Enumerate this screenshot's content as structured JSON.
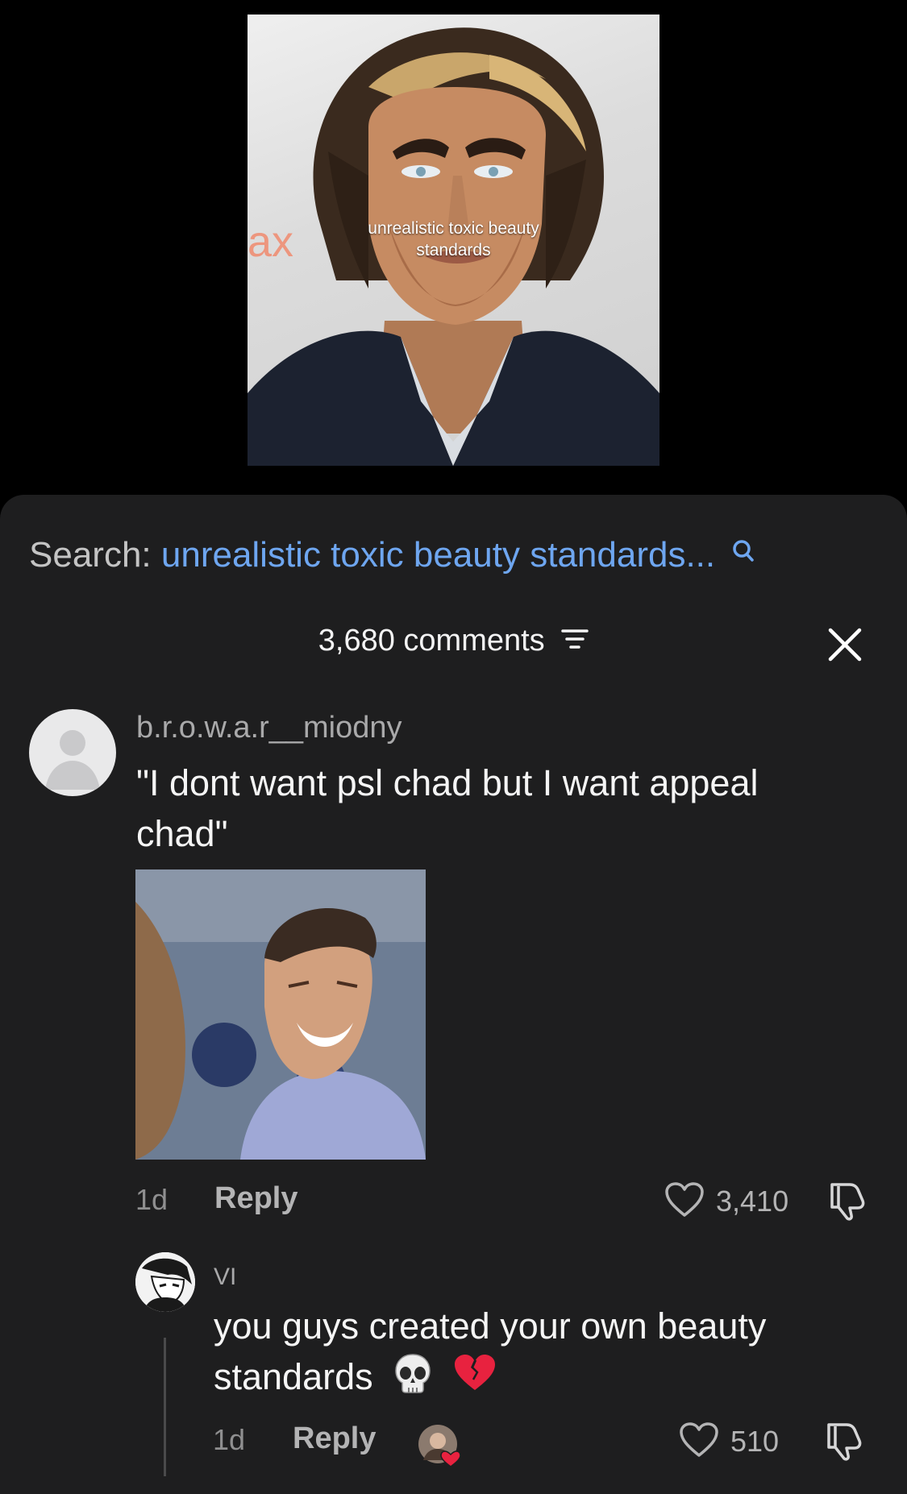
{
  "video": {
    "caption_line1": "unrealistic toxic beauty",
    "caption_line2": "standards",
    "watermark": "ax"
  },
  "search": {
    "prefix": "Search:",
    "query": "unrealistic toxic beauty standards..."
  },
  "comments_header": {
    "count_label": "3,680 comments"
  },
  "comments": [
    {
      "username": "b.r.o.w.a.r__miodny",
      "text": "\"I dont want psl chad but I want appeal chad\"",
      "age": "1d",
      "reply_label": "Reply",
      "likes": "3,410"
    },
    {
      "username": "VI",
      "text": "you guys created your own beauty standards",
      "emojis": [
        "skull-emoji",
        "broken-heart-emoji"
      ],
      "age": "1d",
      "reply_label": "Reply",
      "likes": "510"
    }
  ],
  "colors": {
    "panel_bg": "#1e1e1f",
    "search_query": "#6ea6f0",
    "broken_heart": "#e8223f"
  }
}
